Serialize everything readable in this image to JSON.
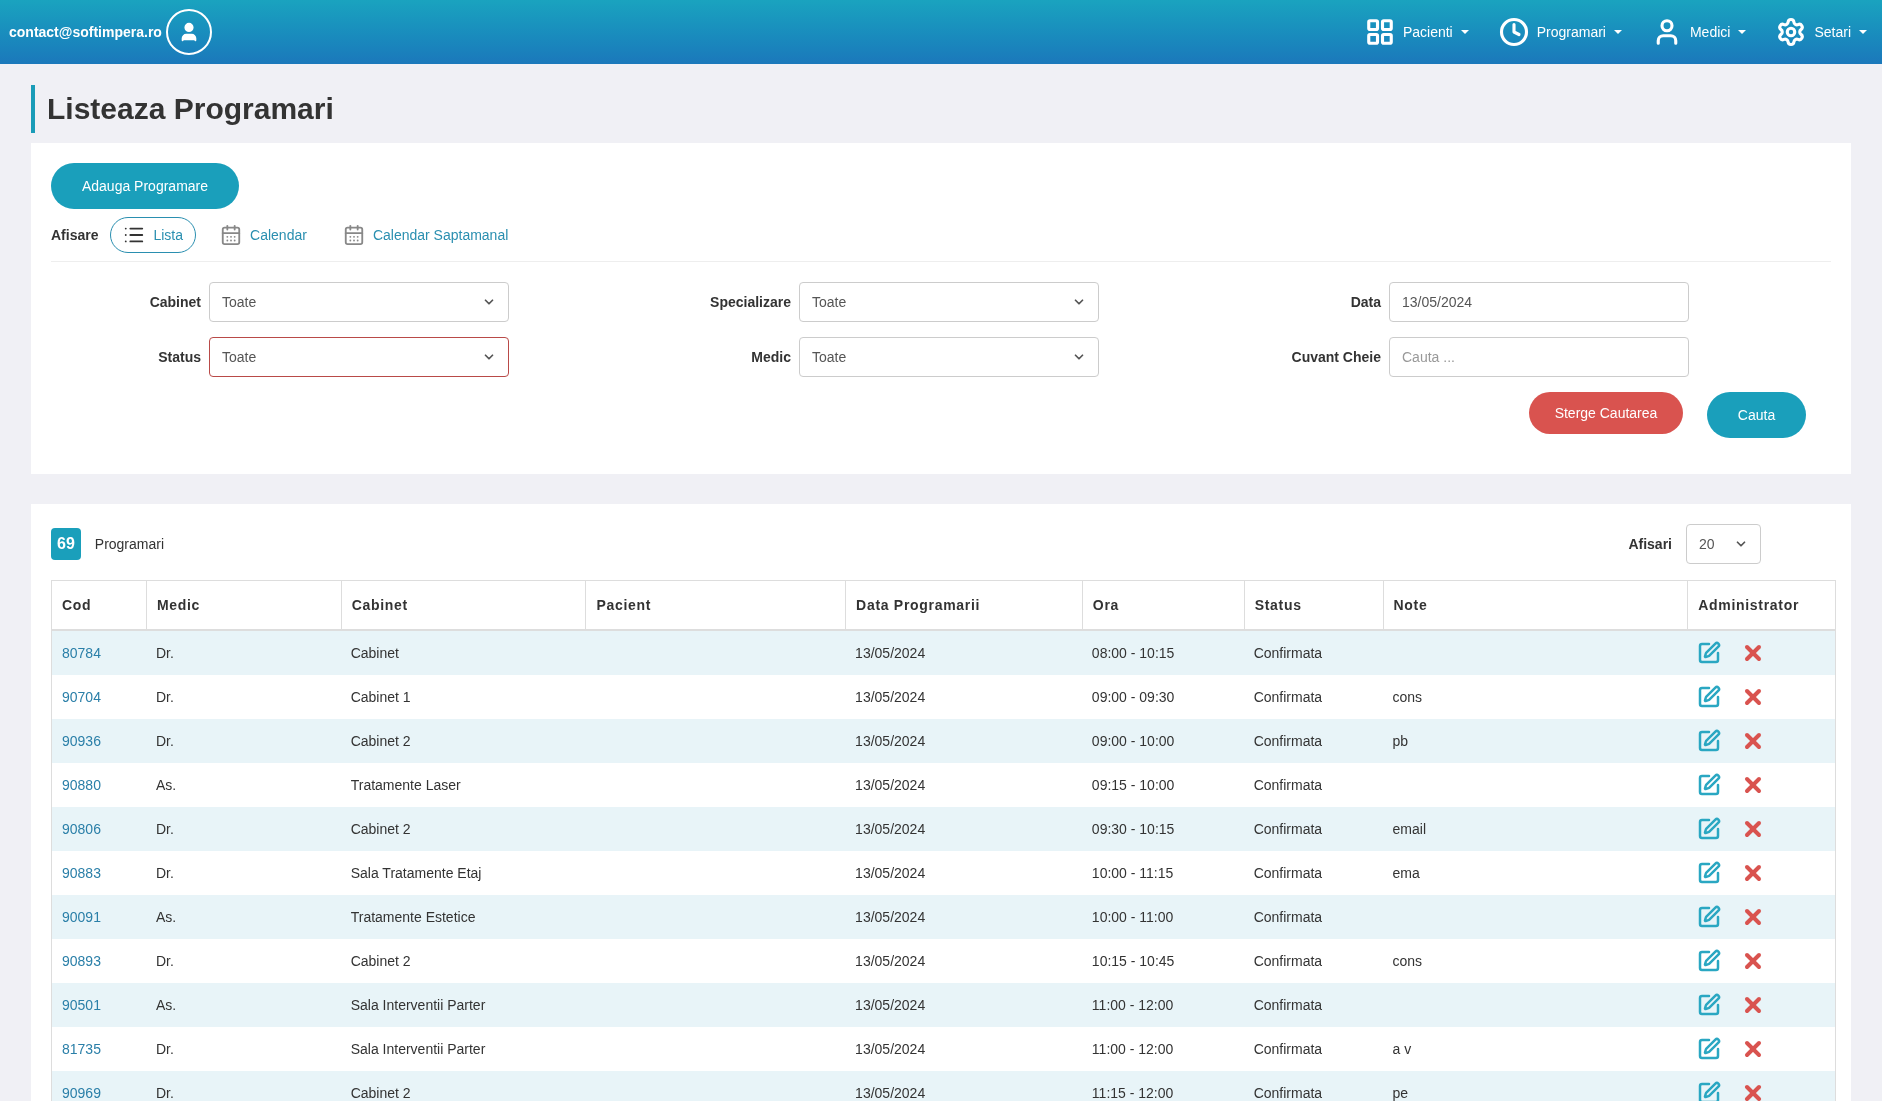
{
  "header": {
    "email": "contact@softimpera.ro",
    "menus": [
      {
        "label": "Pacienti"
      },
      {
        "label": "Programari"
      },
      {
        "label": "Medici"
      },
      {
        "label": "Setari"
      }
    ]
  },
  "page_title": "Listeaza Programari",
  "add_button": "Adauga Programare",
  "view": {
    "label": "Afisare",
    "options": [
      {
        "label": "Lista",
        "selected": true
      },
      {
        "label": "Calendar",
        "selected": false
      },
      {
        "label": "Calendar Saptamanal",
        "selected": false
      }
    ]
  },
  "filters": [
    [
      {
        "label": "Cabinet",
        "kind": "select",
        "value": "Toate",
        "invalid": false
      },
      {
        "label": "Specializare",
        "kind": "select",
        "value": "Toate",
        "invalid": false
      },
      {
        "label": "Data",
        "kind": "input",
        "value": "13/05/2024"
      }
    ],
    [
      {
        "label": "Status",
        "kind": "select",
        "value": "Toate",
        "invalid": true
      },
      {
        "label": "Medic",
        "kind": "select",
        "value": "Toate",
        "invalid": false
      },
      {
        "label": "Cuvant Cheie",
        "kind": "input",
        "placeholder": "Cauta ..."
      }
    ]
  ],
  "clear_button": "Sterge Cautarea",
  "search_button": "Cauta",
  "results": {
    "count": "69",
    "label": "Programari",
    "page_size_label": "Afisari",
    "page_size": "20"
  },
  "table": {
    "columns": [
      "Cod",
      "Medic",
      "Cabinet",
      "Pacient",
      "Data Programarii",
      "Ora",
      "Status",
      "Note",
      "Administrator"
    ],
    "rows": [
      {
        "cod": "80784",
        "medic": "Dr.",
        "cabinet": "Cabinet",
        "data": "13/05/2024",
        "ora": "08:00 - 10:15",
        "status": "Confirmata"
      },
      {
        "cod": "90704",
        "medic": "Dr.",
        "cabinet": "Cabinet 1",
        "data": "13/05/2024",
        "ora": "09:00 - 09:30",
        "status": "Confirmata",
        "note": "cons"
      },
      {
        "cod": "90936",
        "medic": "Dr.",
        "cabinet": "Cabinet 2",
        "data": "13/05/2024",
        "ora": "09:00 - 10:00",
        "status": "Confirmata",
        "note": "pb"
      },
      {
        "cod": "90880",
        "medic": "As.",
        "cabinet": "Tratamente Laser",
        "data": "13/05/2024",
        "ora": "09:15 - 10:00",
        "status": "Confirmata"
      },
      {
        "cod": "90806",
        "medic": "Dr.",
        "cabinet": "Cabinet 2",
        "data": "13/05/2024",
        "ora": "09:30 - 10:15",
        "status": "Confirmata",
        "note": "email"
      },
      {
        "cod": "90883",
        "medic": "Dr.",
        "cabinet": "Sala Tratamente Etaj",
        "data": "13/05/2024",
        "ora": "10:00 - 11:15",
        "status": "Confirmata",
        "note": "ema"
      },
      {
        "cod": "90091",
        "medic": "As.",
        "cabinet": "Tratamente Estetice",
        "data": "13/05/2024",
        "ora": "10:00 - 11:00",
        "status": "Confirmata"
      },
      {
        "cod": "90893",
        "medic": "Dr.",
        "cabinet": "Cabinet 2",
        "data": "13/05/2024",
        "ora": "10:15 - 10:45",
        "status": "Confirmata",
        "note": "cons"
      },
      {
        "cod": "90501",
        "medic": "As.",
        "cabinet": "Sala Interventii Parter",
        "data": "13/05/2024",
        "ora": "11:00 - 12:00",
        "status": "Confirmata"
      },
      {
        "cod": "81735",
        "medic": "Dr.",
        "cabinet": "Sala Interventii Parter",
        "data": "13/05/2024",
        "ora": "11:00 - 12:00",
        "status": "Confirmata",
        "note": "a v"
      },
      {
        "cod": "90969",
        "medic": "Dr.",
        "cabinet": "Cabinet 2",
        "data": "13/05/2024",
        "ora": "11:15 - 12:00",
        "status": "Confirmata",
        "note": "pe"
      }
    ]
  }
}
